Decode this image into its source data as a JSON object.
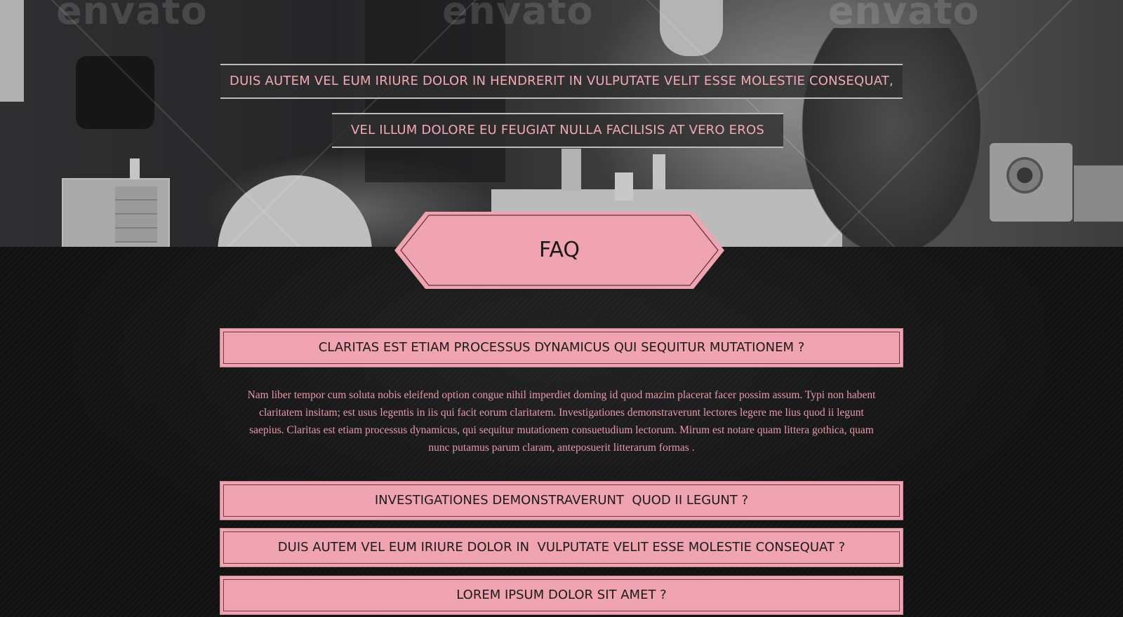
{
  "hero": {
    "watermarks": [
      "envato",
      "envato",
      "envato"
    ],
    "banner_line_1": "DUIS AUTEM VEL EUM IRIURE DOLOR IN HENDRERIT IN VULPUTATE VELIT ESSE MOLESTIE CONSEQUAT,",
    "banner_line_2": "VEL ILLUM DOLORE EU FEUGIAT NULLA FACILISIS AT VERO EROS"
  },
  "faq": {
    "title": "FAQ",
    "items": [
      {
        "question": "CLARITAS EST ETIAM PROCESSUS DYNAMICUS QUI SEQUITUR MUTATIONEM ?",
        "answer": "Nam liber tempor cum soluta nobis eleifend option congue nihil imperdiet doming id quod mazim placerat facer possim assum. Typi non habent claritatem insitam; est usus legentis in iis qui facit eorum claritatem. Investigationes demonstraverunt lectores legere me lius quod ii legunt saepius. Claritas est etiam processus dynamicus, qui sequitur mutationem consuetudium lectorum. Mirum est notare quam littera gothica, quam nunc putamus parum claram, anteposuerit litterarum formas .",
        "expanded": true
      },
      {
        "question": "INVESTIGATIONES DEMONSTRAVERUNT  QUOD II LEGUNT ?",
        "expanded": false
      },
      {
        "question": "DUIS AUTEM VEL EUM IRIURE DOLOR IN  VULPUTATE VELIT ESSE MOLESTIE CONSEQUAT ?",
        "expanded": false
      },
      {
        "question": "LOREM IPSUM DOLOR SIT AMET ?",
        "expanded": false
      }
    ]
  },
  "colors": {
    "accent_pink": "#f0a3b0",
    "text_pink": "#f2a9b4",
    "background_dark": "#151516"
  }
}
